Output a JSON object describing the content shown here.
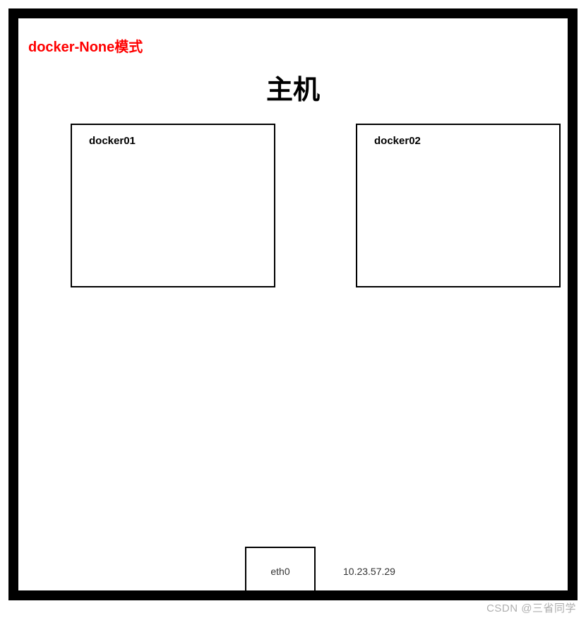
{
  "mode_title": "docker-None模式",
  "host_title": "主机",
  "containers": {
    "left": {
      "label": "docker01"
    },
    "right": {
      "label": "docker02"
    }
  },
  "interface": {
    "name": "eth0",
    "ip": "10.23.57.29"
  },
  "watermark": "CSDN @三省同学"
}
